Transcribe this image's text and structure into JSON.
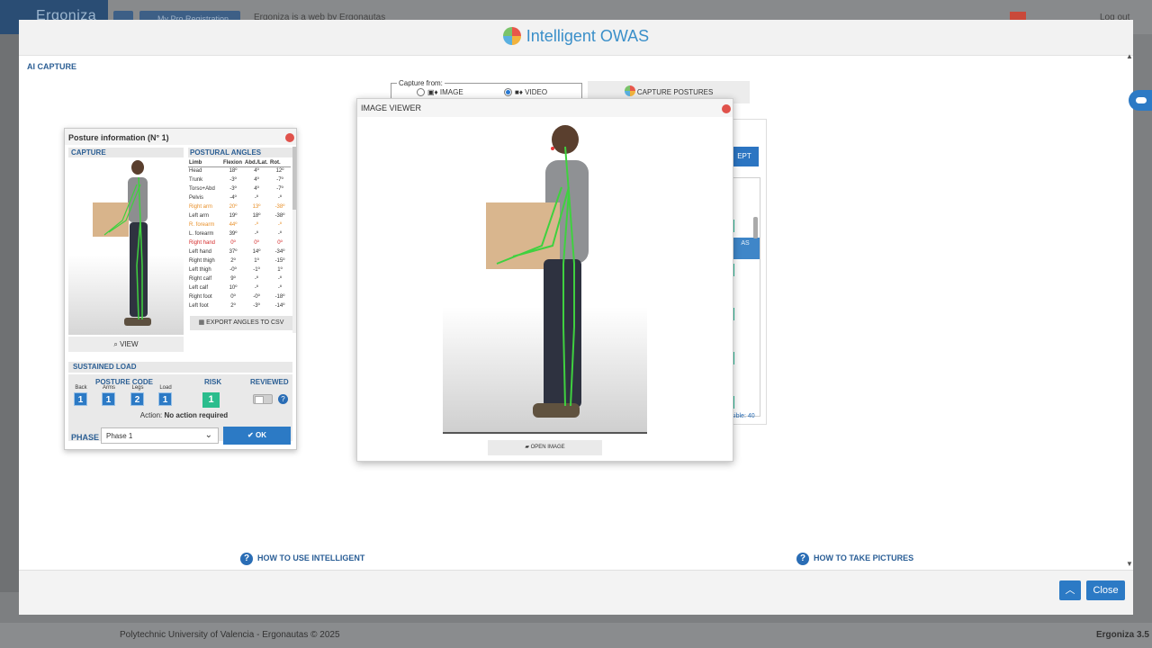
{
  "background": {
    "app_name": "Ergoniza",
    "register_button": "My Pro Registration",
    "tagline": "Ergoniza is a web by Ergonautas",
    "logout": "Log out",
    "footer_left": "Polytechnic University of Valencia - Ergonautas © 2025",
    "footer_right": "Ergoniza 3.5"
  },
  "modal": {
    "title": "Intelligent OWAS",
    "section": "AI CAPTURE",
    "close_label": "Close",
    "help_left": "HOW TO USE INTELLIGENT",
    "help_right": "HOW TO TAKE PICTURES"
  },
  "capture": {
    "legend": "Capture from:",
    "option_image": "IMAGE",
    "option_video": "VIDEO",
    "selected": "VIDEO",
    "button": "CAPTURE POSTURES"
  },
  "hidden_panel": {
    "accept": "EPT",
    "column": "AS",
    "visible": "isible: 40"
  },
  "posture": {
    "title": "Posture information (N° 1)",
    "capture_head": "CAPTURE",
    "view_button": "VIEW",
    "angles_head": "POSTURAL ANGLES",
    "columns": [
      "Limb",
      "Flexion",
      "Abd./Lat.",
      "Rot."
    ],
    "rows": [
      {
        "limb": "Head",
        "flex": "18º",
        "abd": "4º",
        "rot": "12º",
        "state": ""
      },
      {
        "limb": "Trunk",
        "flex": "-3º",
        "abd": "4º",
        "rot": "-7º",
        "state": ""
      },
      {
        "limb": "Torso+Abd",
        "flex": "-3º",
        "abd": "4º",
        "rot": "-7º",
        "state": ""
      },
      {
        "limb": "Pelvis",
        "flex": "-4º",
        "abd": "-º",
        "rot": "-º",
        "state": ""
      },
      {
        "limb": "Right arm",
        "flex": "20º",
        "abd": "13º",
        "rot": "-38º",
        "state": "orange"
      },
      {
        "limb": "Left arm",
        "flex": "19º",
        "abd": "18º",
        "rot": "-38º",
        "state": ""
      },
      {
        "limb": "R. forearm",
        "flex": "44º",
        "abd": "-º",
        "rot": "-º",
        "state": "orange"
      },
      {
        "limb": "L. forearm",
        "flex": "39º",
        "abd": "-º",
        "rot": "-º",
        "state": ""
      },
      {
        "limb": "Right hand",
        "flex": "0º",
        "abd": "0º",
        "rot": "0º",
        "state": "red"
      },
      {
        "limb": "Left hand",
        "flex": "37º",
        "abd": "14º",
        "rot": "-34º",
        "state": ""
      },
      {
        "limb": "Right thigh",
        "flex": "2º",
        "abd": "1º",
        "rot": "-15º",
        "state": ""
      },
      {
        "limb": "Left thigh",
        "flex": "-0º",
        "abd": "-1º",
        "rot": "1º",
        "state": ""
      },
      {
        "limb": "Right calf",
        "flex": "9º",
        "abd": "-º",
        "rot": "-º",
        "state": ""
      },
      {
        "limb": "Left calf",
        "flex": "10º",
        "abd": "-º",
        "rot": "-º",
        "state": ""
      },
      {
        "limb": "Right foot",
        "flex": "0º",
        "abd": "-0º",
        "rot": "-18º",
        "state": ""
      },
      {
        "limb": "Left foot",
        "flex": "2º",
        "abd": "-3º",
        "rot": "-14º",
        "state": ""
      }
    ],
    "export_button": "EXPORT ANGLES TO CSV",
    "sustained_load": "SUSTAINED LOAD",
    "posture_code_head": "POSTURE CODE",
    "risk_head": "RISK",
    "reviewed_head": "REVIEWED",
    "codes": [
      {
        "label": "Back",
        "value": "1"
      },
      {
        "label": "Arms",
        "value": "1"
      },
      {
        "label": "Legs",
        "value": "2"
      },
      {
        "label": "Load",
        "value": "1"
      }
    ],
    "risk_value": "1",
    "action_prefix": "Action:",
    "action_text": "No action required",
    "phase_label": "PHASE",
    "phase_value": "Phase 1",
    "ok_button": "OK"
  },
  "viewer": {
    "title": "IMAGE VIEWER",
    "open_button": "OPEN IMAGE"
  },
  "colors": {
    "accent": "#2c7ac5",
    "risk_green": "#2bbd8d",
    "warn_orange": "#e8902a",
    "danger_red": "#d52b2b"
  }
}
